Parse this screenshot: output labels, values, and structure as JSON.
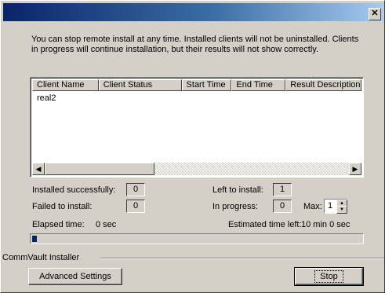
{
  "window": {
    "close_glyph": "✕"
  },
  "message": "You can stop remote install at any time. Installed clients will not be uninstalled. Clients in progress will continue installation, but their results will not show correctly.",
  "list": {
    "columns": [
      "Client Name",
      "Client Status",
      "Start Time",
      "End Time",
      "Result Description"
    ],
    "rows": [
      [
        "real2",
        "",
        "",
        "",
        ""
      ]
    ],
    "scroll_left_icon": "◀",
    "scroll_right_icon": "▶"
  },
  "stats": {
    "installed_label": "Installed successfully:",
    "installed_value": "0",
    "failed_label": "Failed to install:",
    "failed_value": "0",
    "left_label": "Left to install:",
    "left_value": "1",
    "inprogress_label": "In progress:",
    "inprogress_value": "0",
    "max_label": "Max:",
    "max_value": "1",
    "elapsed_label": "Elapsed time:",
    "elapsed_value": "0 sec",
    "estimated_label": "Estimated time left:",
    "estimated_value": "10 min 0 sec"
  },
  "progress_fraction": 0.015,
  "group_label": "CommVault Installer",
  "buttons": {
    "advanced": "Advanced Settings",
    "stop": "Stop"
  }
}
